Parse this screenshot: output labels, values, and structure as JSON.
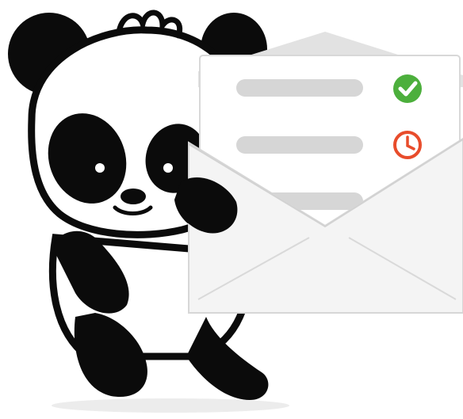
{
  "illustration": {
    "subject": "panda-holding-envelope",
    "colors": {
      "panda_black": "#0b0b0b",
      "panda_white": "#ffffff",
      "envelope_body": "#f3f3f3",
      "envelope_edge": "#dcdcdc",
      "envelope_lines": "#d9d9d9",
      "paper": "#ffffff",
      "text_placeholder": "#d6d6d6",
      "check_green": "#4caf3c",
      "clock_red": "#e84c2b",
      "shadow": "#e9e9e9"
    },
    "letter_items": [
      {
        "icon": "check-circle-icon",
        "status": "done"
      },
      {
        "icon": "clock-icon",
        "status": "pending"
      },
      {
        "icon": "partial-icon",
        "status": "hidden"
      }
    ]
  }
}
